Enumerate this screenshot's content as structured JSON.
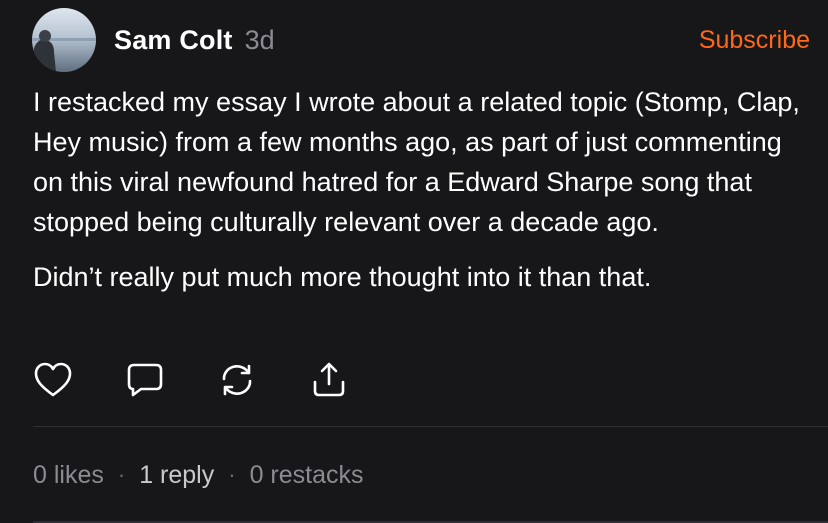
{
  "author": {
    "name": "Sam Colt",
    "time": "3d"
  },
  "subscribe_label": "Subscribe",
  "post": {
    "paragraphs": [
      "I restacked my essay I wrote about a related topic (Stomp, Clap, Hey music) from a few months ago, as part of just commenting on this viral newfound hatred for a Edward Sharpe song that stopped being culturally relevant over a decade ago.",
      "Didn’t really put much more thought into it than that."
    ]
  },
  "actions": {
    "icons": [
      "heart-icon",
      "comment-icon",
      "restack-icon",
      "share-icon"
    ]
  },
  "stats": {
    "likes": "0 likes",
    "replies": "1 reply",
    "restacks": "0 restacks",
    "separator": "·"
  },
  "colors": {
    "background": "#17171a",
    "accent": "#ff6719",
    "muted": "#8b8b90"
  }
}
